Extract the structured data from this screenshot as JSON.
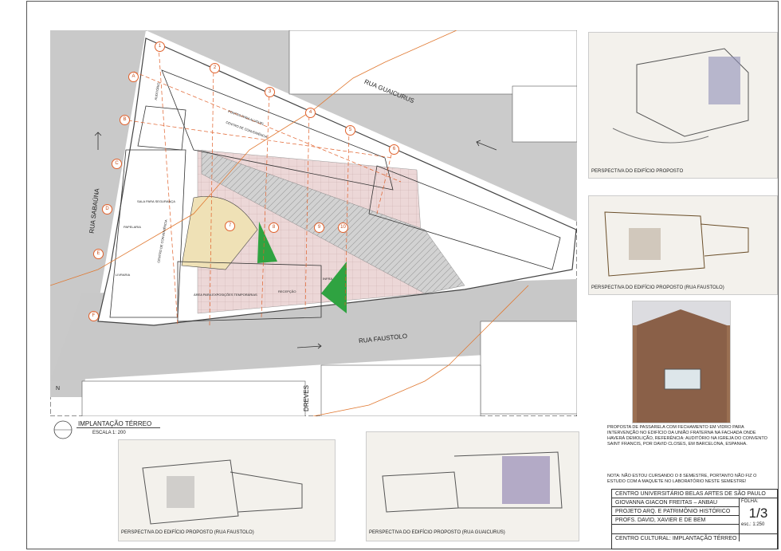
{
  "plan": {
    "title": "IMPLANTAÇÃO TÉRREO",
    "scale": "ESCALA 1: 200",
    "north": "N",
    "streets": {
      "guaicurus": "RUA GUAICURUS",
      "sabauna": "RUA SABAÚNA",
      "faustolo": "RUA FAUSTOLO",
      "dreves": "DREVES"
    },
    "axes_num": [
      "1",
      "2",
      "3",
      "4",
      "5",
      "6",
      "7",
      "8",
      "9",
      "10"
    ],
    "axes_letter": [
      "A",
      "B",
      "C",
      "D",
      "E",
      "F"
    ],
    "rooms": {
      "auditorio": "AUDITÓRIO",
      "pontos": "PONTOS PARA ALUGUEL",
      "centro": "CENTRO DE CONVENIÊNCIA",
      "sala_parq": "SALA PARA SEGURANÇA",
      "papelaria": "PAPELARIA",
      "livraria": "LIVRARIA",
      "centro2": "CENTRO DE CONVENIÊNCIA",
      "area_exp": "ÁREA PARA EXPOSIÇÕES TEMPORÁRIAS",
      "recepcao": "RECEPÇÃO",
      "infra": "INFRA"
    }
  },
  "sketches": {
    "s1": "PERSPECTIVA DO EDIFÍCIO PROPOSTO",
    "s2": "PERSPECTIVA DO EDIFÍCIO PROPOSTO (RUA FAUSTOLO)",
    "s4": "PERSPECTIVA DO EDIFÍCIO PROPOSTO (RUA FAUSTOLO)",
    "s5": "PERSPECTIVA DO EDIFÍCIO PROPOSTO (RUA GUAICURUS)",
    "hand_guaicurus": "RUA GUAICURUS",
    "hand_faustolo": "RUA FAUSTOLO"
  },
  "notes": {
    "ref": "PROPOSTA DE PASSARELA COM FECHAMENTO EM VIDRO PARA INTERVENÇÃO NO EDIFÍCIO DA UNIÃO FRATERNA NA FACHADA ONDE HAVERÁ DEMOLIÇÃO, REFERÊNCIA: AUDITÓRIO NA IGREJA DO CONVENTO SAINT FRANCIS, POR DAVID CLOSES, EM BARCELONA, ESPANHA.",
    "maquete": "NOTA: NÃO ESTOU CURSANDO O 8 SEMESTRE, PORTANTO NÃO FIZ O ESTUDO COM A MAQUETE NO LABORATÓRIO NESTE SEMESTRE!"
  },
  "titleblock": {
    "school": "CENTRO UNIVERSITÁRIO BELAS ARTES DE SÃO PAULO",
    "student": "GIOVANNA GIACON FREITAS – ANBAU",
    "course": "PROJETO ARQ. E PATRIMÔNIO HISTÓRICO",
    "profs": "PROFS. DAVID, XAVIER E DE BEM",
    "sheet_title": "CENTRO CULTURAL: IMPLANTAÇÃO TÉRREO",
    "folha_label": "FOLHA:",
    "folha": "1/3",
    "escala": "esc.: 1:250"
  },
  "colors": {
    "street": "#c9c9c9",
    "paving": "#e9d4d4",
    "green": "#2fa341",
    "auditorium": "#efe1b6",
    "axis": "#e0602a"
  }
}
